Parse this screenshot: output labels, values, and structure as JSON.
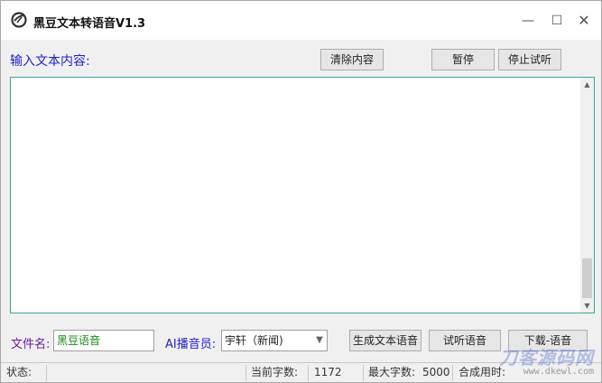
{
  "window": {
    "title": "黑豆文本转语音V1.3",
    "controls": {
      "minimize": "—",
      "maximize": "☐",
      "close": "✕"
    }
  },
  "main": {
    "input_label": "输入文本内容:",
    "buttons": {
      "clear": "清除内容",
      "pause": "暂停",
      "stop_preview": "停止试听"
    },
    "text_content": ""
  },
  "bottom": {
    "file_label": "文件名:",
    "file_name": "黑豆语音",
    "voice_label": "AI播音员:",
    "voice_selected": "宇轩（新闻)",
    "buttons": {
      "generate": "生成文本语音",
      "listen": "试听语音",
      "download": "下载-语音"
    }
  },
  "statusbar": {
    "status_label": "状态:",
    "status_value": "",
    "current_chars_label": "当前字数:",
    "current_chars_value": "1172",
    "max_chars_label": "最大字数:",
    "max_chars_value": "5000",
    "synth_time_label": "合成用时:"
  },
  "watermark": {
    "brand": "刀客源码网",
    "url": "www.dkewl.com"
  },
  "colors": {
    "accent_blue": "#1f1fc8",
    "file_label_purple": "#6a1aa0",
    "file_value_green": "#1a8a1a",
    "textarea_border": "#3aa89a"
  }
}
